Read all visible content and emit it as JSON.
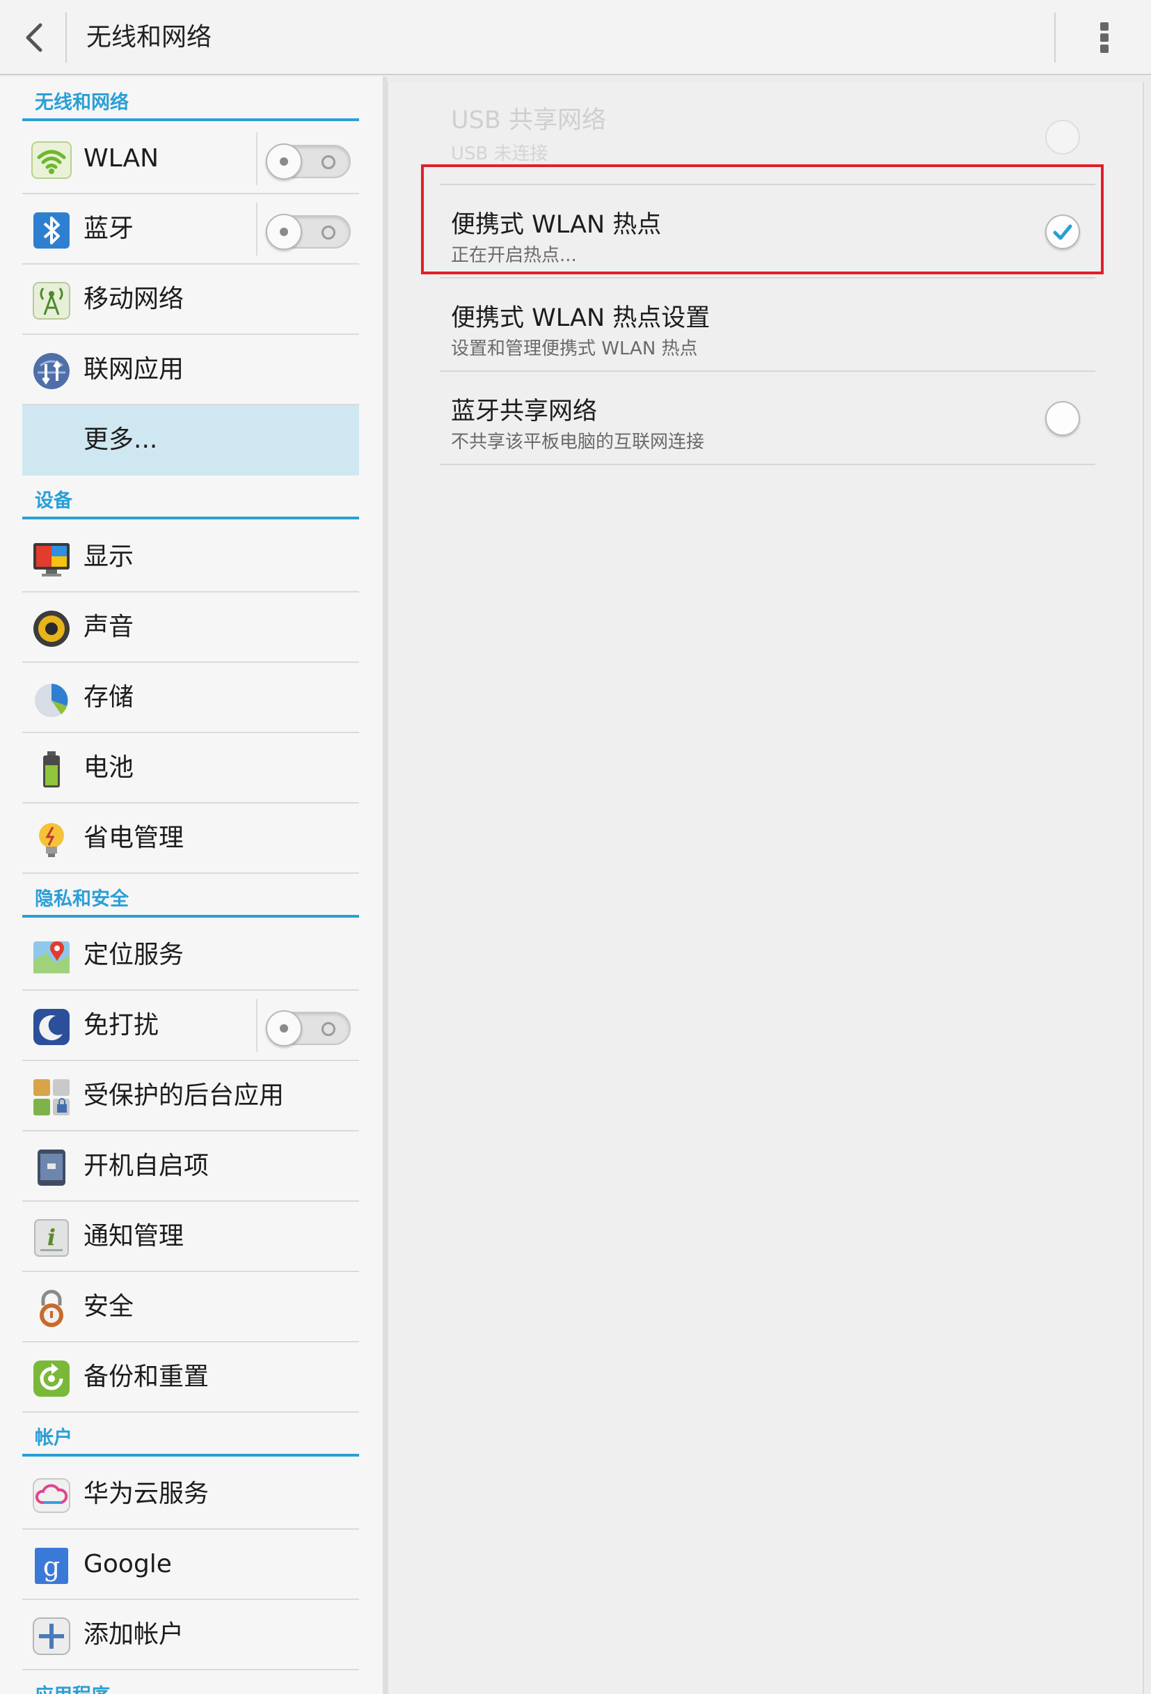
{
  "action_bar": {
    "title": "无线和网络",
    "back_icon": "chevron-left-icon",
    "overflow_icon": "overflow-menu-icon"
  },
  "sidebar": {
    "sections": [
      {
        "header": "无线和网络"
      },
      {
        "header": "设备"
      },
      {
        "header": "隐私和安全"
      },
      {
        "header": "帐户"
      },
      {
        "header": "应用程序"
      }
    ],
    "items": [
      {
        "label": "WLAN",
        "icon": "wifi-icon",
        "toggle": "off"
      },
      {
        "label": "蓝牙",
        "icon": "bluetooth-icon",
        "toggle": "off"
      },
      {
        "label": "移动网络",
        "icon": "mobile-network-icon"
      },
      {
        "label": "联网应用",
        "icon": "network-apps-icon"
      },
      {
        "label": "更多...",
        "selected": true
      },
      {
        "label": "显示",
        "icon": "display-icon"
      },
      {
        "label": "声音",
        "icon": "speaker-icon"
      },
      {
        "label": "存储",
        "icon": "storage-pie-icon"
      },
      {
        "label": "电池",
        "icon": "battery-icon"
      },
      {
        "label": "省电管理",
        "icon": "power-saving-bulb-icon"
      },
      {
        "label": "定位服务",
        "icon": "location-icon"
      },
      {
        "label": "免打扰",
        "icon": "moon-icon",
        "toggle": "off"
      },
      {
        "label": "受保护的后台应用",
        "icon": "protected-apps-icon"
      },
      {
        "label": "开机自启项",
        "icon": "startup-apps-icon"
      },
      {
        "label": "通知管理",
        "icon": "notification-info-icon"
      },
      {
        "label": "安全",
        "icon": "lock-icon"
      },
      {
        "label": "备份和重置",
        "icon": "backup-reset-icon"
      },
      {
        "label": "华为云服务",
        "icon": "cloud-icon"
      },
      {
        "label": "Google",
        "icon": "google-icon"
      },
      {
        "label": "添加帐户",
        "icon": "add-icon"
      }
    ]
  },
  "main": {
    "prefs": [
      {
        "title": "USB 共享网络",
        "summary": "USB 未连接",
        "enabled": false,
        "checked": false
      },
      {
        "title": "便携式 WLAN 热点",
        "summary": "正在开启热点...",
        "enabled": true,
        "checked": true
      },
      {
        "title": "便携式 WLAN 热点设置",
        "summary": "设置和管理便携式 WLAN 热点",
        "enabled": true
      },
      {
        "title": "蓝牙共享网络",
        "summary": "不共享该平板电脑的互联网连接",
        "enabled": true,
        "checked": false
      }
    ]
  },
  "colors": {
    "accent": "#2a9fd6",
    "selected_bg": "#cfe7f1",
    "highlight_box": "#e0202a"
  }
}
